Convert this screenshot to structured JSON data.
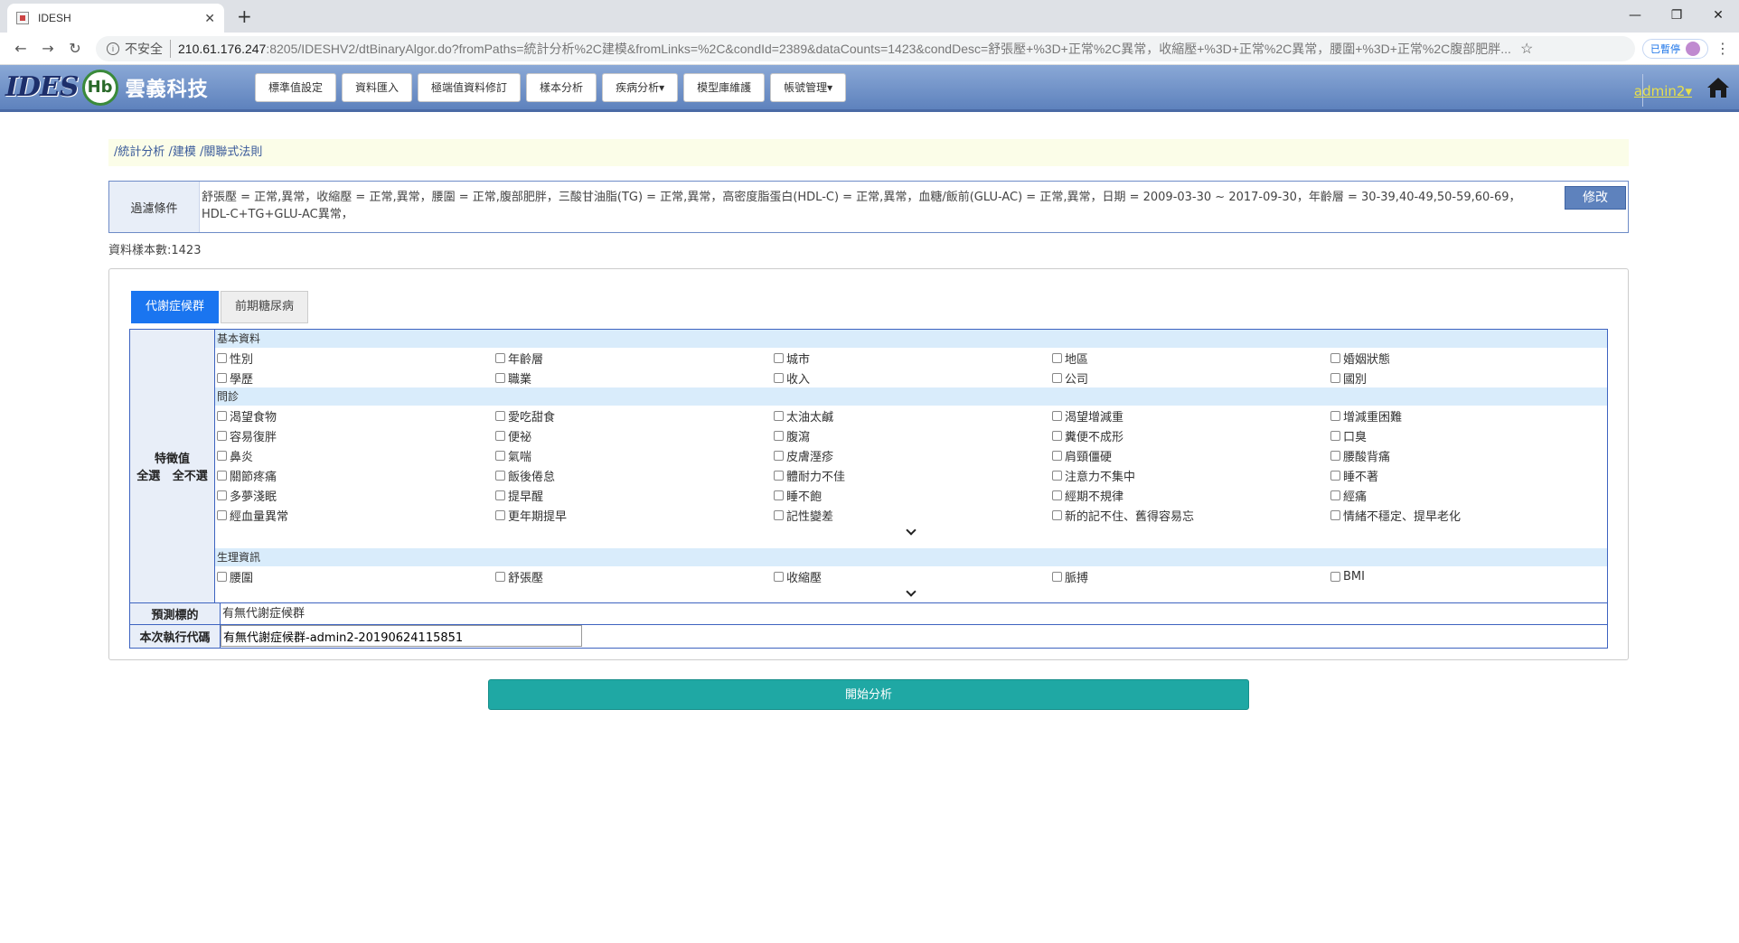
{
  "browser": {
    "tab_title": "IDESH",
    "insecure_label": "不安全",
    "url_host": "210.61.176.247",
    "url_path": ":8205/IDESHV2/dtBinaryAlgor.do?fromPaths=統計分析%2C建模&fromLinks=%2C&condId=2389&dataCounts=1423&condDesc=舒張壓+%3D+正常%2C異常，收縮壓+%3D+正常%2C異常，腰圍+%3D+正常%2C腹部肥胖...",
    "paused_label": "已暫停"
  },
  "header": {
    "logo_text": "IDES",
    "logo_badge": "Hb",
    "company": "雲義科技",
    "menu": [
      {
        "label": "標準值設定"
      },
      {
        "label": "資料匯入"
      },
      {
        "label": "極端值資料修訂"
      },
      {
        "label": "樣本分析"
      },
      {
        "label": "疾病分析▾"
      },
      {
        "label": "模型庫維護"
      },
      {
        "label": "帳號管理▾"
      }
    ],
    "user": "admin2▾"
  },
  "breadcrumb": "/統計分析 /建模 /關聯式法則",
  "filter": {
    "label": "過濾條件",
    "text": "舒張壓 = 正常,異常，收縮壓 = 正常,異常，腰圍 = 正常,腹部肥胖，三酸甘油脂(TG) = 正常,異常，高密度脂蛋白(HDL-C) = 正常,異常，血糖/飯前(GLU-AC) = 正常,異常，日期 = 2009-03-30 ~ 2017-09-30，年齡層 = 30-39,40-49,50-59,60-69，HDL-C+TG+GLU-AC異常，",
    "edit_label": "修改"
  },
  "sample_count": "資料樣本數:1423",
  "tabs": [
    {
      "label": "代謝症候群",
      "active": true
    },
    {
      "label": "前期糖尿病",
      "active": false
    }
  ],
  "features": {
    "label": "特徵值",
    "select_all": "全選",
    "select_none": "全不選",
    "sections": [
      {
        "title": "基本資料",
        "rows": [
          [
            "性別",
            "年齡層",
            "城市",
            "地區",
            "婚姻狀態"
          ],
          [
            "學歷",
            "職業",
            "收入",
            "公司",
            "國別"
          ]
        ]
      },
      {
        "title": "問診",
        "rows": [
          [
            "渴望食物",
            "愛吃甜食",
            "太油太鹹",
            "渴望增減重",
            "增減重困難"
          ],
          [
            "容易復胖",
            "便祕",
            "腹瀉",
            "糞便不成形",
            "口臭"
          ],
          [
            "鼻炎",
            "氣喘",
            "皮膚溼疹",
            "肩頸僵硬",
            "腰酸背痛"
          ],
          [
            "關節疼痛",
            "飯後倦怠",
            "體耐力不佳",
            "注意力不集中",
            "睡不著"
          ],
          [
            "多夢淺眠",
            "提早醒",
            "睡不飽",
            "經期不規律",
            "經痛"
          ],
          [
            "經血量異常",
            "更年期提早",
            "記性變差",
            "新的記不住、舊得容易忘",
            "情緒不穩定、提早老化"
          ]
        ]
      },
      {
        "title": "生理資訊",
        "rows": [
          [
            "腰圍",
            "舒張壓",
            "收縮壓",
            "脈搏",
            "BMI"
          ]
        ]
      }
    ]
  },
  "predict": {
    "label": "預測標的",
    "value": "有無代謝症候群"
  },
  "exec": {
    "label": "本次執行代碼",
    "value": "有無代謝症候群-admin2-20190624115851"
  },
  "start_button": "開始分析"
}
